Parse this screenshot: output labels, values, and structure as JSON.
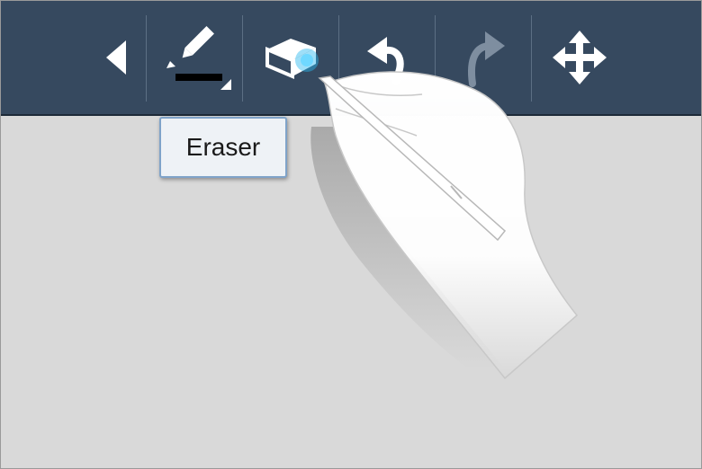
{
  "toolbar": {
    "tools": [
      {
        "name": "back",
        "icon": "back-arrow-icon"
      },
      {
        "name": "pen",
        "icon": "pen-icon"
      },
      {
        "name": "eraser",
        "icon": "eraser-icon",
        "selected": true
      },
      {
        "name": "undo",
        "icon": "undo-icon"
      },
      {
        "name": "redo",
        "icon": "redo-icon",
        "disabled": true
      },
      {
        "name": "move",
        "icon": "move-icon"
      }
    ]
  },
  "tooltip": {
    "label": "Eraser"
  },
  "colors": {
    "toolbar": "#36495f",
    "canvas": "#d9d9d9",
    "icon": "#ffffff",
    "icon_disabled": "#7e8ea0",
    "highlight": "#29b8f0"
  },
  "illustration": {
    "icon": "hand-with-stylus-icon"
  }
}
